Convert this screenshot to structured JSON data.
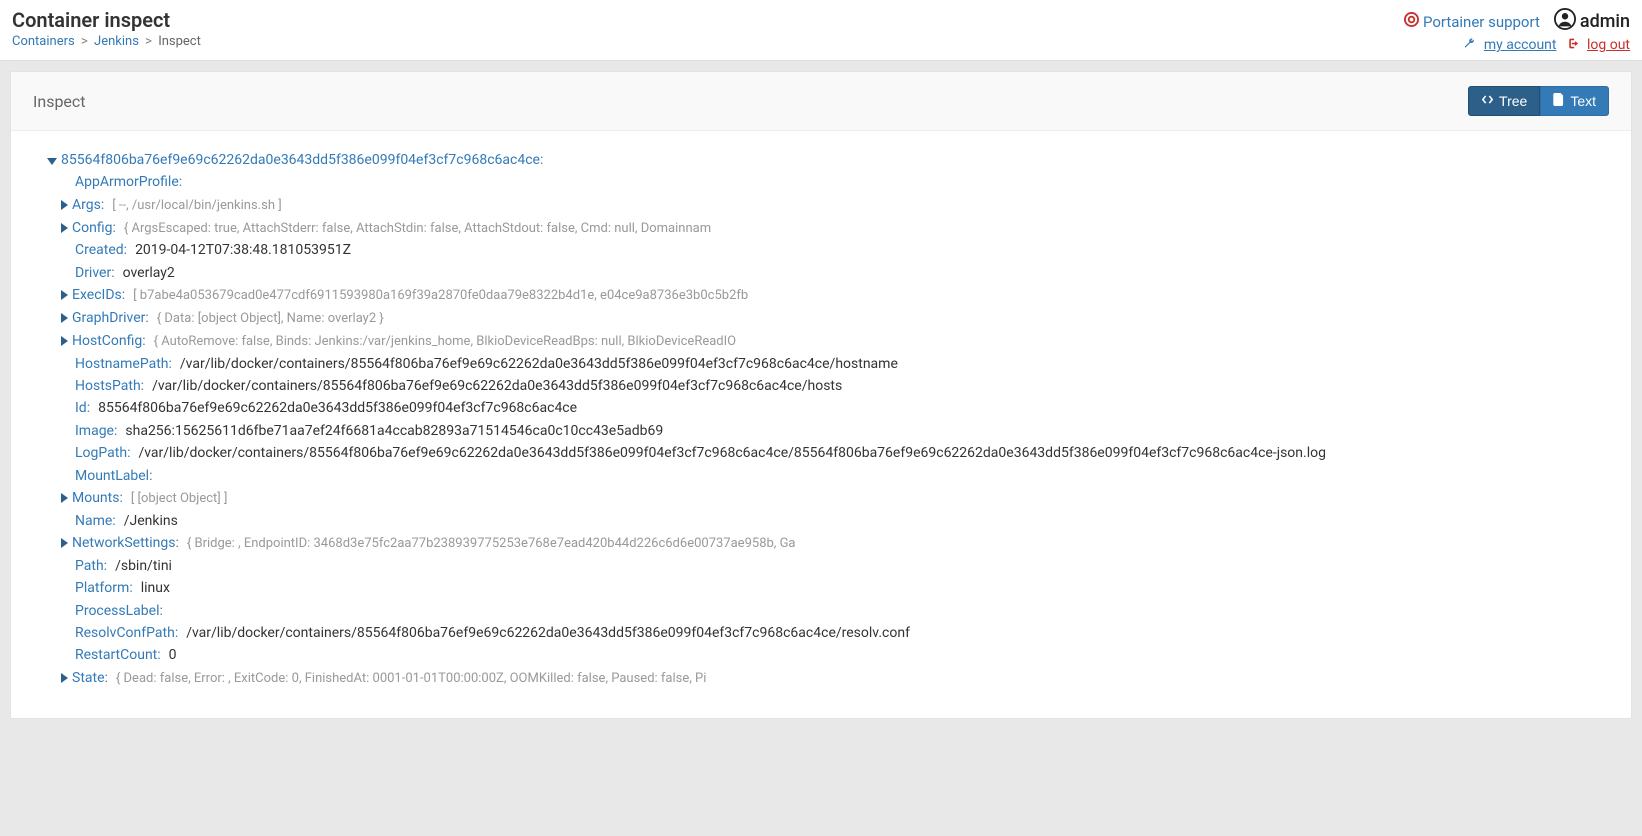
{
  "header": {
    "title": "Container inspect",
    "breadcrumb": {
      "containers": "Containers",
      "jenkins": "Jenkins",
      "inspect": "Inspect"
    },
    "support": "Portainer support",
    "user": "admin",
    "my_account": "my account",
    "log_out": "log out"
  },
  "panel": {
    "title": "Inspect",
    "tree_btn": "Tree",
    "text_btn": "Text"
  },
  "tree": {
    "root_key": "85564f806ba76ef9e69c62262da0e3643dd5f386e099f04ef3cf7c968c6ac4ce",
    "AppArmorProfile_key": "AppArmorProfile",
    "AppArmorProfile_val": "",
    "Args_key": "Args",
    "Args_preview": "[ --, /usr/local/bin/jenkins.sh ]",
    "Config_key": "Config",
    "Config_preview": "{ ArgsEscaped: true, AttachStderr: false, AttachStdin: false, AttachStdout: false, Cmd: null, Domainnam",
    "Created_key": "Created",
    "Created_val": "2019-04-12T07:38:48.181053951Z",
    "Driver_key": "Driver",
    "Driver_val": "overlay2",
    "ExecIDs_key": "ExecIDs",
    "ExecIDs_preview": "[ b7abe4a053679cad0e477cdf6911593980a169f39a2870fe0daa79e8322b4d1e, e04ce9a8736e3b0c5b2fb",
    "GraphDriver_key": "GraphDriver",
    "GraphDriver_preview": "{ Data: [object Object], Name: overlay2 }",
    "HostConfig_key": "HostConfig",
    "HostConfig_preview": "{ AutoRemove: false, Binds: Jenkins:/var/jenkins_home, BlkioDeviceReadBps: null, BlkioDeviceReadIO",
    "HostnamePath_key": "HostnamePath",
    "HostnamePath_val": "/var/lib/docker/containers/85564f806ba76ef9e69c62262da0e3643dd5f386e099f04ef3cf7c968c6ac4ce/hostname",
    "HostsPath_key": "HostsPath",
    "HostsPath_val": "/var/lib/docker/containers/85564f806ba76ef9e69c62262da0e3643dd5f386e099f04ef3cf7c968c6ac4ce/hosts",
    "Id_key": "Id",
    "Id_val": "85564f806ba76ef9e69c62262da0e3643dd5f386e099f04ef3cf7c968c6ac4ce",
    "Image_key": "Image",
    "Image_val": "sha256:15625611d6fbe71aa7ef24f6681a4ccab82893a71514546ca0c10cc43e5adb69",
    "LogPath_key": "LogPath",
    "LogPath_val": "/var/lib/docker/containers/85564f806ba76ef9e69c62262da0e3643dd5f386e099f04ef3cf7c968c6ac4ce/85564f806ba76ef9e69c62262da0e3643dd5f386e099f04ef3cf7c968c6ac4ce-json.log",
    "MountLabel_key": "MountLabel",
    "MountLabel_val": "",
    "Mounts_key": "Mounts",
    "Mounts_preview": "[ [object Object] ]",
    "Name_key": "Name",
    "Name_val": "/Jenkins",
    "NetworkSettings_key": "NetworkSettings",
    "NetworkSettings_preview": "{ Bridge: , EndpointID: 3468d3e75fc2aa77b238939775253e768e7ead420b44d226c6d6e00737ae958b, Ga",
    "Path_key": "Path",
    "Path_val": "/sbin/tini",
    "Platform_key": "Platform",
    "Platform_val": "linux",
    "ProcessLabel_key": "ProcessLabel",
    "ProcessLabel_val": "",
    "ResolvConfPath_key": "ResolvConfPath",
    "ResolvConfPath_val": "/var/lib/docker/containers/85564f806ba76ef9e69c62262da0e3643dd5f386e099f04ef3cf7c968c6ac4ce/resolv.conf",
    "RestartCount_key": "RestartCount",
    "RestartCount_val": "0",
    "State_key": "State",
    "State_preview": "{ Dead: false, Error: , ExitCode: 0, FinishedAt: 0001-01-01T00:00:00Z, OOMKilled: false, Paused: false, Pi"
  }
}
